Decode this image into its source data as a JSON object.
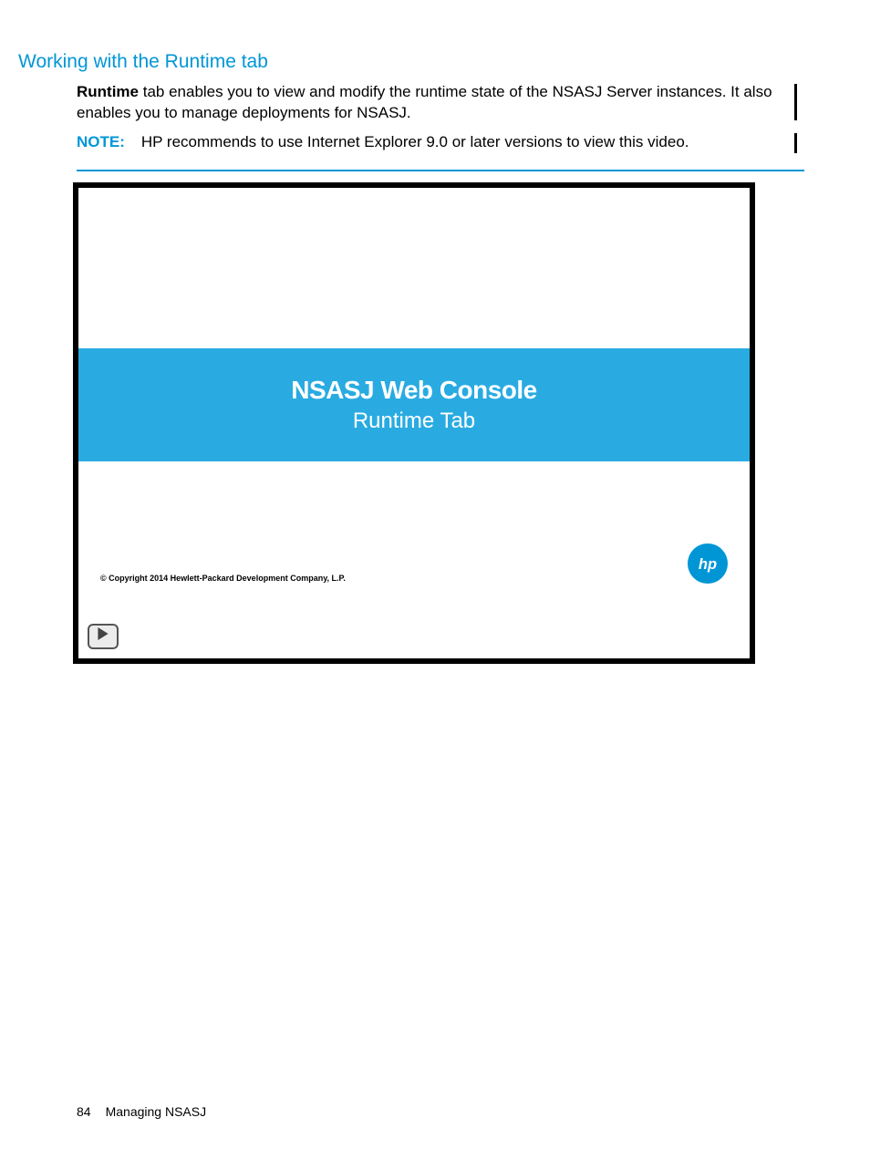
{
  "heading": "Working with the Runtime tab",
  "intro_bold": "Runtime",
  "intro_rest": " tab enables you to view and modify the runtime state of the NSASJ Server instances. It also enables you to manage deployments for NSASJ.",
  "note_label": "NOTE:",
  "note_text": "HP recommends to use Internet Explorer 9.0 or later versions to view this video.",
  "video": {
    "title": "NSASJ Web Console",
    "subtitle": "Runtime Tab",
    "copyright": "© Copyright 2014 Hewlett-Packard Development Company, L.P.",
    "logo": "hp-logo",
    "play_icon": "play-icon"
  },
  "footer": {
    "page_number": "84",
    "section": "Managing NSASJ"
  }
}
